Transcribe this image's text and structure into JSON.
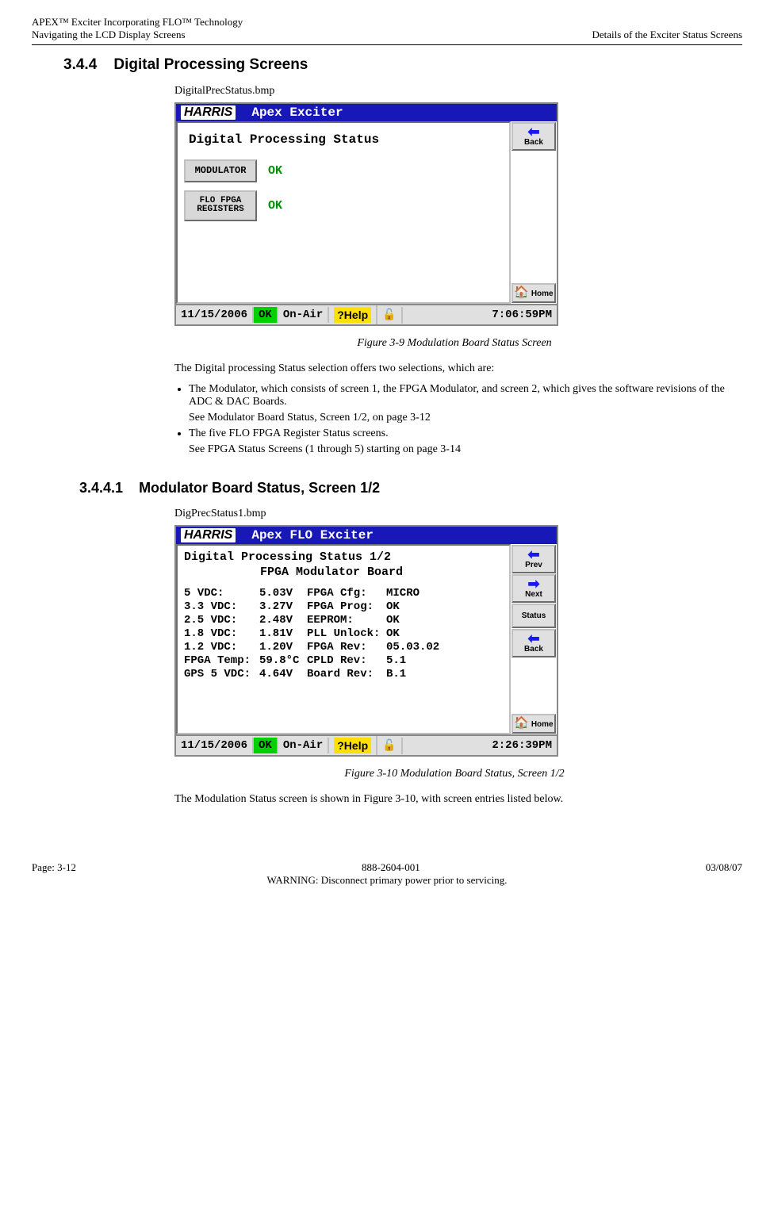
{
  "header": {
    "left_top": "APEX™ Exciter Incorporating FLO™ Technology",
    "left_bottom": "Navigating the LCD Display Screens",
    "right_bottom": "Details of the Exciter Status Screens"
  },
  "section344": {
    "number": "3.4.4",
    "title": "Digital Processing Screens",
    "filename": "DigitalPrecStatus.bmp"
  },
  "lcd1": {
    "title": "Apex Exciter",
    "logo": "HARRIS",
    "main_heading": "Digital Processing Status",
    "buttons": [
      {
        "label": "MODULATOR",
        "value": "OK"
      },
      {
        "label": "FLO FPGA REGISTERS",
        "value": "OK"
      }
    ],
    "side": {
      "back": "Back",
      "home": "Home"
    },
    "status": {
      "date": "11/15/2006",
      "ok": "OK",
      "onair": "On-Air",
      "help": "?Help",
      "time": "7:06:59PM"
    }
  },
  "figure39": {
    "caption": "Figure 3-9  Modulation Board Status Screen"
  },
  "para1": "The Digital processing Status selection offers two selections, which are:",
  "bullets": {
    "b1": "The Modulator, which consists of screen 1, the FPGA Modulator, and screen 2, which gives the software revisions of the ADC & DAC Boards.",
    "b1_sub": "See Modulator Board Status, Screen 1/2, on page 3-12",
    "b2": "The five FLO FPGA Register Status screens.",
    "b2_sub": "See FPGA Status Screens (1 through 5) starting on page 3-14"
  },
  "section3441": {
    "number": "3.4.4.1",
    "title": "Modulator Board Status, Screen 1/2",
    "filename": "DigPrecStatus1.bmp"
  },
  "lcd2": {
    "title": "Apex FLO Exciter",
    "logo": "HARRIS",
    "heading1": "Digital Processing Status 1/2",
    "heading2": "FPGA Modulator Board",
    "rows": [
      {
        "l1": "5 VDC:",
        "v1": "5.03V",
        "l2": "FPGA Cfg:",
        "v2": "MICRO"
      },
      {
        "l1": "3.3 VDC:",
        "v1": "3.27V",
        "l2": "FPGA Prog:",
        "v2": "OK"
      },
      {
        "l1": "2.5 VDC:",
        "v1": "2.48V",
        "l2": "EEPROM:",
        "v2": "OK"
      },
      {
        "l1": "1.8 VDC:",
        "v1": "1.81V",
        "l2": "PLL Unlock:",
        "v2": "OK"
      },
      {
        "l1": "1.2 VDC:",
        "v1": "1.20V",
        "l2": "FPGA Rev:",
        "v2": "05.03.02"
      },
      {
        "l1": "FPGA Temp:",
        "v1": "59.8°C",
        "l2": "CPLD Rev:",
        "v2": "5.1"
      },
      {
        "l1": "GPS 5 VDC:",
        "v1": "4.64V",
        "l2": "Board Rev:",
        "v2": "B.1"
      }
    ],
    "side": {
      "prev": "Prev",
      "next": "Next",
      "status": "Status",
      "back": "Back",
      "home": "Home"
    },
    "status": {
      "date": "11/15/2006",
      "ok": "OK",
      "onair": "On-Air",
      "help": "?Help",
      "time": "2:26:39PM"
    }
  },
  "figure310": {
    "caption": "Figure 3-10  Modulation Board Status, Screen 1/2"
  },
  "para2": "The Modulation Status screen is shown in Figure 3-10, with screen entries listed below.",
  "footer": {
    "left": "Page: 3-12",
    "center": "888-2604-001",
    "right": "03/08/07",
    "warning": "WARNING: Disconnect primary power prior to servicing."
  }
}
